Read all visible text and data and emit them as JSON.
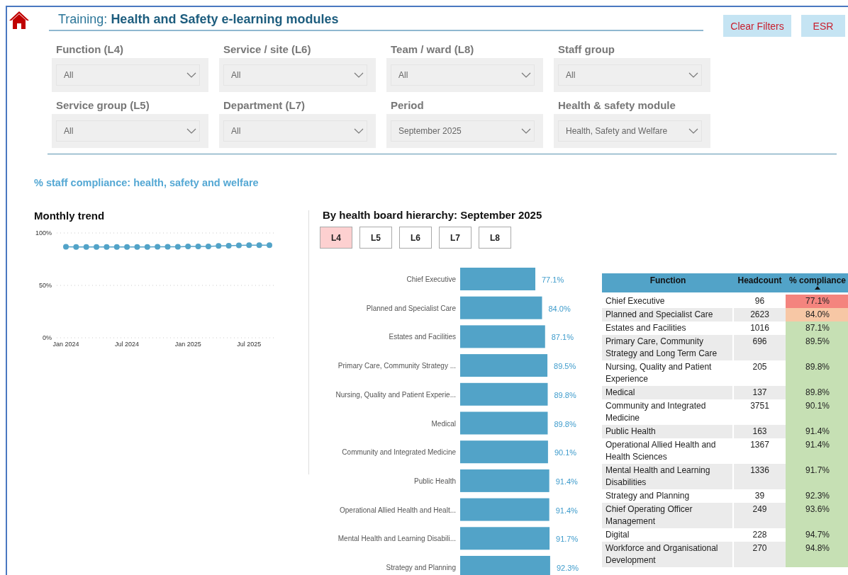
{
  "header": {
    "title": "Training: **Health and Safety e-learning modules**",
    "buttons": [
      "Clear Filters",
      "ESR"
    ]
  },
  "filters": [
    {
      "label": "Function (L4)",
      "value": "All"
    },
    {
      "label": "Service / site (L6)",
      "value": "All"
    },
    {
      "label": "Team / ward (L8)",
      "value": "All"
    },
    {
      "label": "Staff group",
      "value": "All"
    },
    {
      "label": "Service group (L5)",
      "value": "All"
    },
    {
      "label": "Department (L7)",
      "value": "All"
    },
    {
      "label": "Period",
      "value": "September 2025"
    },
    {
      "label": "Health & safety module",
      "value": "Health, Safety and Welfare"
    }
  ],
  "section_title": "% staff compliance: health, safety and welfare",
  "trend": {
    "title": "Monthly trend",
    "chart_data": {
      "type": "line",
      "categories": [
        "Jan 2024",
        null,
        null,
        null,
        null,
        null,
        "Jul 2024",
        null,
        null,
        null,
        null,
        null,
        "Jan 2025",
        null,
        null,
        null,
        null,
        null,
        "Jul 2025",
        null,
        null
      ],
      "ylim": [
        0,
        100
      ],
      "yticks": [
        {
          "value": 0,
          "label": "0%"
        },
        {
          "value": 50,
          "label": "50%"
        },
        {
          "value": 100,
          "label": "100%"
        }
      ],
      "series": [
        {
          "color": "#52a3c8",
          "marker": "circle",
          "values": [
            86.9,
            86.7,
            86.6,
            86.7,
            86.7,
            86.6,
            86.7,
            86.7,
            86.6,
            86.8,
            86.8,
            86.8,
            87.1,
            87.2,
            87.2,
            87.6,
            87.9,
            88.1,
            88.3,
            88.3,
            88.3
          ]
        }
      ]
    }
  },
  "hierarchy": {
    "title": "By health board hierarchy: September 2025",
    "levels": [
      {
        "label": "L4",
        "selected": true
      },
      {
        "label": "L5",
        "selected": false
      },
      {
        "label": "L6",
        "selected": false
      },
      {
        "label": "L7",
        "selected": false
      },
      {
        "label": "L8",
        "selected": false
      }
    ],
    "chart_data": {
      "type": "bar",
      "orientation": "horizontal",
      "color": "#52a3c8",
      "categories": [
        "Chief Executive",
        "Planned and Specialist Care",
        "Estates and Facilities",
        "Primary Care, Community Strategy ...",
        "Nursing, Quality and Patient Experie...",
        "Medical",
        "Community and Integrated Medicine",
        "Public Health",
        "Operational Allied Health and Healt...",
        "Mental Health and Learning Disabili...",
        "Strategy and Planning"
      ],
      "values": [
        77.1,
        84.0,
        87.1,
        89.5,
        89.8,
        89.8,
        90.1,
        91.4,
        91.4,
        91.7,
        92.3
      ],
      "value_labels": [
        "77.1%",
        "84.0%",
        "87.1%",
        "89.5%",
        "89.8%",
        "89.8%",
        "90.1%",
        "91.4%",
        "91.4%",
        "91.7%",
        "92.3%"
      ]
    }
  },
  "table": {
    "columns": [
      {
        "label": "Function"
      },
      {
        "label": "Headcount"
      },
      {
        "label": "% compliance",
        "sorted": true
      }
    ],
    "rows": [
      {
        "function": "Chief Executive",
        "headcount": "96",
        "compliance": "77.1%",
        "color": "#f4847e"
      },
      {
        "function": "Planned and Specialist Care",
        "headcount": "2623",
        "compliance": "84.0%",
        "color": "#f7c7a5"
      },
      {
        "function": "Estates and Facilities",
        "headcount": "1016",
        "compliance": "87.1%",
        "color": "#c6e0b4"
      },
      {
        "function": "Primary Care, Community Strategy and Long Term Care",
        "headcount": "696",
        "compliance": "89.5%",
        "color": "#c6e0b4"
      },
      {
        "function": "Nursing, Quality and Patient Experience",
        "headcount": "205",
        "compliance": "89.8%",
        "color": "#c6e0b4"
      },
      {
        "function": "Medical",
        "headcount": "137",
        "compliance": "89.8%",
        "color": "#c6e0b4"
      },
      {
        "function": "Community and Integrated Medicine",
        "headcount": "3751",
        "compliance": "90.1%",
        "color": "#c6e0b4"
      },
      {
        "function": "Public Health",
        "headcount": "163",
        "compliance": "91.4%",
        "color": "#c6e0b4"
      },
      {
        "function": "Operational Allied Health and Health Sciences",
        "headcount": "1367",
        "compliance": "91.4%",
        "color": "#c6e0b4"
      },
      {
        "function": "Mental Health and Learning Disabilities",
        "headcount": "1336",
        "compliance": "91.7%",
        "color": "#c6e0b4"
      },
      {
        "function": "Strategy and Planning",
        "headcount": "39",
        "compliance": "92.3%",
        "color": "#c6e0b4"
      },
      {
        "function": "Chief Operating Officer Management",
        "headcount": "249",
        "compliance": "93.6%",
        "color": "#c6e0b4"
      },
      {
        "function": "Digital",
        "headcount": "228",
        "compliance": "94.7%",
        "color": "#c6e0b4"
      },
      {
        "function": "Workforce and Organisational Development",
        "headcount": "270",
        "compliance": "94.8%",
        "color": "#c6e0b4"
      }
    ]
  }
}
